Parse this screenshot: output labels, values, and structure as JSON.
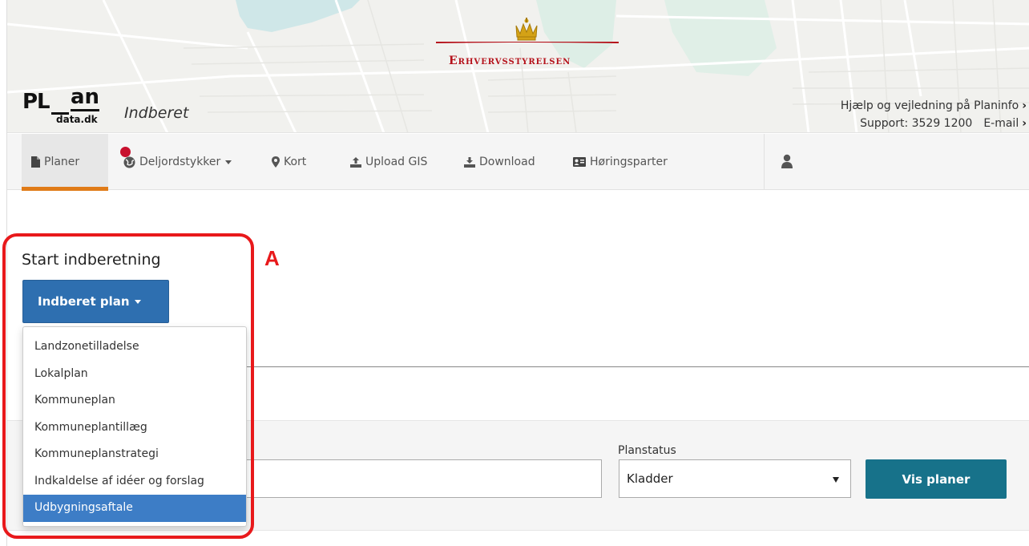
{
  "header": {
    "agency_name": "Erhvervsstyrelsen",
    "logo_pl": "PL",
    "logo_an": "an",
    "logo_domain": "data.dk",
    "app_title": "Indberet",
    "help_link": "Hjælp og vejledning på Planinfo",
    "support_label": "Support: 3529 1200",
    "email_label": "E-mail",
    "chevron": "›"
  },
  "nav": {
    "items": [
      {
        "label": "Planer",
        "icon": "file-icon",
        "active": true
      },
      {
        "label": "Deljordstykker",
        "icon": "globe-icon",
        "has_dropdown": true,
        "notification": true
      },
      {
        "label": "Kort",
        "icon": "map-marker-icon"
      },
      {
        "label": "Upload GIS",
        "icon": "upload-icon"
      },
      {
        "label": "Download",
        "icon": "download-icon"
      },
      {
        "label": "Høringsparter",
        "icon": "contact-card-icon"
      }
    ],
    "user_icon": "user-icon"
  },
  "main": {
    "section_title": "Start indberetning",
    "report_button": "Indberet plan",
    "report_dropdown": {
      "options": [
        "Landzonetilladelse",
        "Lokalplan",
        "Kommuneplan",
        "Kommuneplantillæg",
        "Kommuneplanstrategi",
        "Indkaldelse af idéer og forslag",
        "Udbygningsaftale"
      ],
      "highlighted": "Udbygningsaftale"
    },
    "filter": {
      "text_value": "",
      "planstatus_label": "Planstatus",
      "planstatus_value": "Kladder",
      "show_button": "Vis planer"
    }
  },
  "annotation": {
    "letter": "A",
    "color": "#e8191b"
  },
  "colors": {
    "primary_button": "#2e6fb0",
    "show_button": "#17728a",
    "active_tab_accent": "#e07b18",
    "agency_red": "#b5121b"
  }
}
